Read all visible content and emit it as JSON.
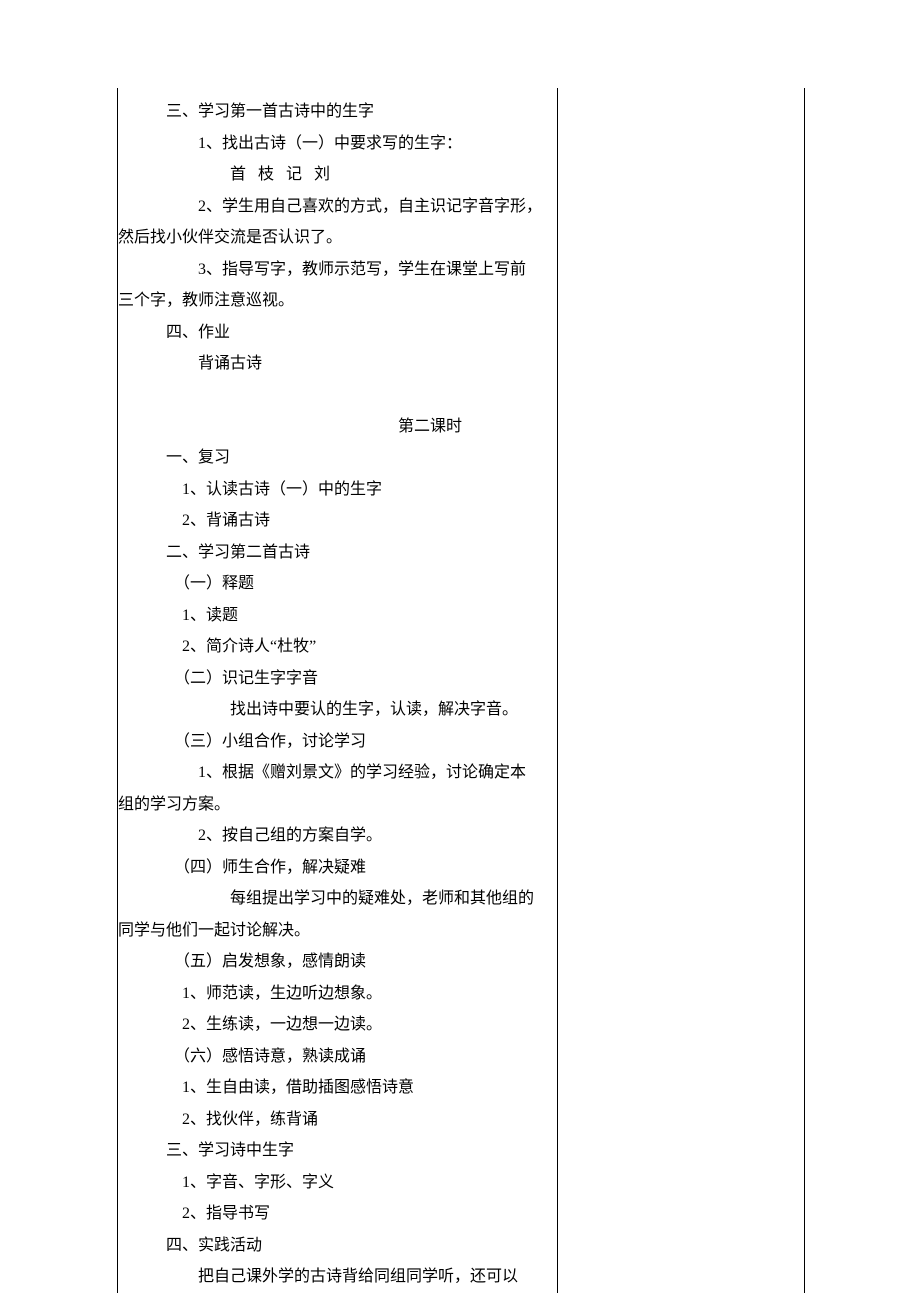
{
  "s1_h": "三、学习第一首古诗中的生字",
  "s1_1": "1、找出古诗（一）中要求写的生字：",
  "s1_chars": "首   枝   记   刘",
  "s1_2a": "2、学生用自己喜欢的方式，自主识记字音字形，",
  "s1_2b": "然后找小伙伴交流是否认识了。",
  "s1_3a": "3、指导写字，教师示范写，学生在课堂上写前",
  "s1_3b": "三个字，教师注意巡视。",
  "s2_h": "四、作业",
  "s2_1": "背诵古诗",
  "subhead": "第二课时",
  "p2_s1_h": "一、复习",
  "p2_s1_1": "1、认读古诗（一）中的生字",
  "p2_s1_2": "2、背诵古诗",
  "p2_s2_h": "二、学习第二首古诗",
  "p2_s2_sub1": "（一）释题",
  "p2_s2_sub1_1": "1、读题",
  "p2_s2_sub1_2": "2、简介诗人“杜牧”",
  "p2_s2_sub2": "（二）识记生字字音",
  "p2_s2_sub2_t": "找出诗中要认的生字，认读，解决字音。",
  "p2_s2_sub3": "（三）小组合作，讨论学习",
  "p2_s2_sub3_1a": "1、根据《赠刘景文》的学习经验，讨论确定本",
  "p2_s2_sub3_1b": "组的学习方案。",
  "p2_s2_sub3_2": "2、按自己组的方案自学。",
  "p2_s2_sub4": "（四）师生合作，解决疑难",
  "p2_s2_sub4_ta": "每组提出学习中的疑难处，老师和其他组的",
  "p2_s2_sub4_tb": "同学与他们一起讨论解决。",
  "p2_s2_sub5": "（五）启发想象，感情朗读",
  "p2_s2_sub5_1": "1、师范读，生边听边想象。",
  "p2_s2_sub5_2": "2、生练读，一边想一边读。",
  "p2_s2_sub6": "（六）感悟诗意，熟读成诵",
  "p2_s2_sub6_1": "1、生自由读，借助插图感悟诗意",
  "p2_s2_sub6_2": "2、找伙伴，练背诵",
  "p2_s3_h": "三、学习诗中生字",
  "p2_s3_1": "1、字音、字形、字义",
  "p2_s3_2": "2、指导书写",
  "p2_s4_h": "四、实践活动",
  "p2_s4_ta": "把自己课外学的古诗背给同组同学听，还可以"
}
